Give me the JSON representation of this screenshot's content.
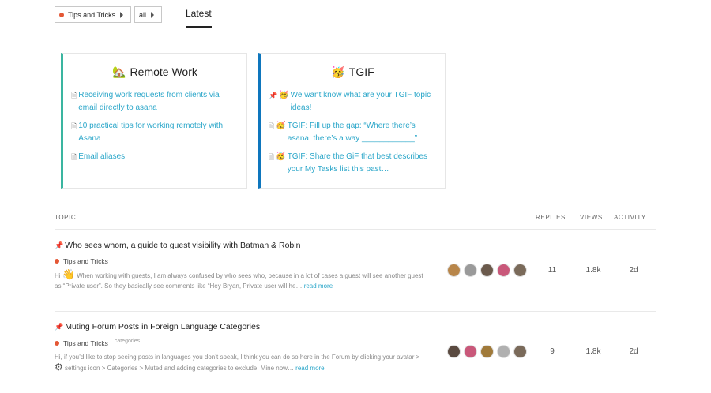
{
  "nav": {
    "category_filter": "Tips and Tricks",
    "tag_filter": "all",
    "tab_latest": "Latest"
  },
  "categories": [
    {
      "name": "Remote Work",
      "emoji": "🏡",
      "color": "#3ab5a0",
      "topics": [
        {
          "title": "Receiving work requests from clients via email directly to asana"
        },
        {
          "title": "10 practical tips for working remotely with Asana"
        },
        {
          "title": "Email aliases"
        }
      ]
    },
    {
      "name": "TGIF",
      "emoji": "🥳",
      "color": "#0e76bd",
      "topics": [
        {
          "title": "We want know what are your TGIF topic ideas!",
          "pinned": true
        },
        {
          "title": "TGIF: Fill up the gap: “Where there’s asana, there’s a way ____________”"
        },
        {
          "title": "TGIF: Share the GiF that best describes your My Tasks list this past…"
        }
      ]
    }
  ],
  "table": {
    "headers": {
      "topic": "TOPIC",
      "replies": "REPLIES",
      "views": "VIEWS",
      "activity": "ACTIVITY"
    }
  },
  "topics": [
    {
      "title": "Who sees whom, a guide to guest visibility with Batman & Robin",
      "category": "Tips and Tricks",
      "tag": "",
      "excerpt_start": "Hi ",
      "excerpt_body": " When working with guests, I am always confused by who sees who, because in a lot of cases a guest will see another guest as “Private user”. So they basically see comments like “Hey Bryan, Private user will he…",
      "excerpt_end": "",
      "read_more": "read more",
      "replies": "11",
      "views": "1.8k",
      "activity": "2d",
      "avatar_colors": [
        "#b8864a",
        "#9a9a9a",
        "#6b5a4c",
        "#c9587a",
        "#7a6a5a"
      ]
    },
    {
      "title": "Muting Forum Posts in Foreign Language Categories",
      "category": "Tips and Tricks",
      "tag": "categories",
      "excerpt_start": "Hi, if you’d like to stop seeing posts in languages you don’t speak, I think you can do so here in the Forum by clicking your avatar > ",
      "excerpt_body": " settings icon > Categories > Muted and adding categories to exclude. Mine now…",
      "excerpt_end": "",
      "read_more": "read more",
      "replies": "9",
      "views": "1.8k",
      "activity": "2d",
      "avatar_colors": [
        "#5a4a40",
        "#c9587a",
        "#a07a3a",
        "#b0b0b0",
        "#7a6a5a"
      ]
    }
  ],
  "colors": {
    "accent_link": "#2aa6c9",
    "category_dot": "#e45735"
  }
}
